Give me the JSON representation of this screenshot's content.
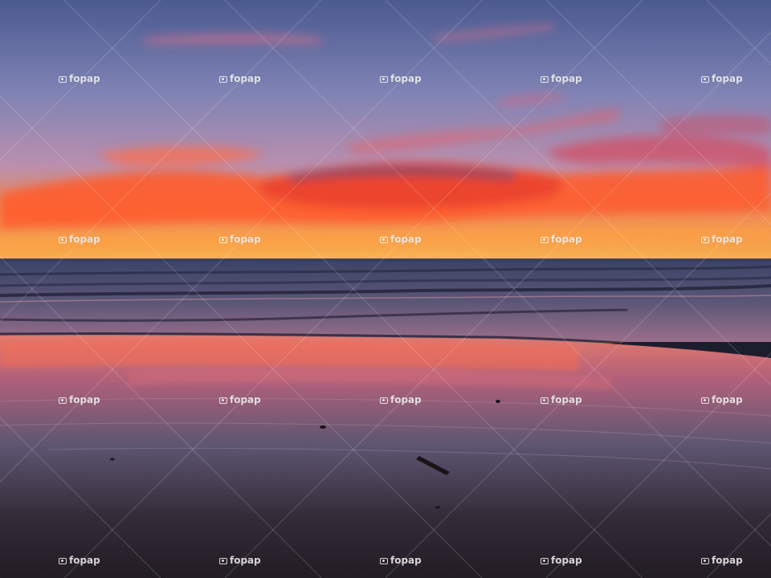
{
  "photo": {
    "subject": "sunset-over-ocean-beach",
    "palette": {
      "sky_top": "#4e5c92",
      "sky_mid": "#8f8fb8",
      "sky_horizon": "#f5a64a",
      "cloud_glow": "#ff5a2e",
      "ocean": "#3a4468",
      "sand_reflection": "#d2626a",
      "sand_dark": "#2a2430"
    }
  },
  "watermark": {
    "text": "fopap",
    "icon": "camera-icon"
  }
}
